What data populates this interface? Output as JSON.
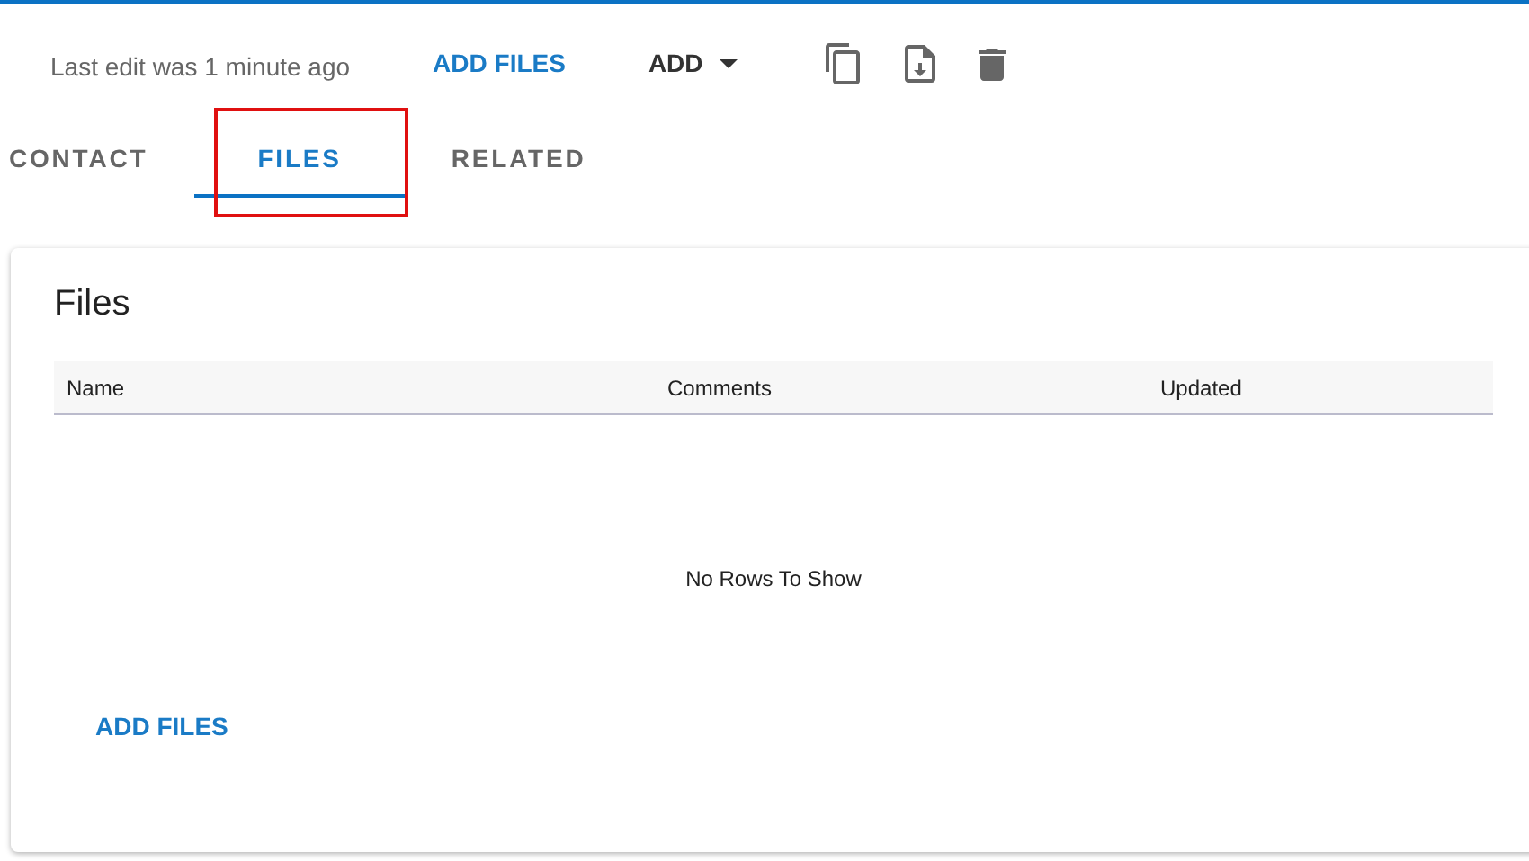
{
  "toolbar": {
    "last_edit": "Last edit was 1 minute ago",
    "add_files": "ADD FILES",
    "add_menu": "ADD"
  },
  "tabs": [
    {
      "label": "CONTACT",
      "selected": false,
      "highlighted": false
    },
    {
      "label": "FILES",
      "selected": true,
      "highlighted": true
    },
    {
      "label": "RELATED",
      "selected": false,
      "highlighted": false
    }
  ],
  "files_card": {
    "title": "Files",
    "table": {
      "columns": [
        "Name",
        "Comments",
        "Updated"
      ],
      "empty_message": "No Rows To Show"
    },
    "add_files": "ADD FILES"
  }
}
